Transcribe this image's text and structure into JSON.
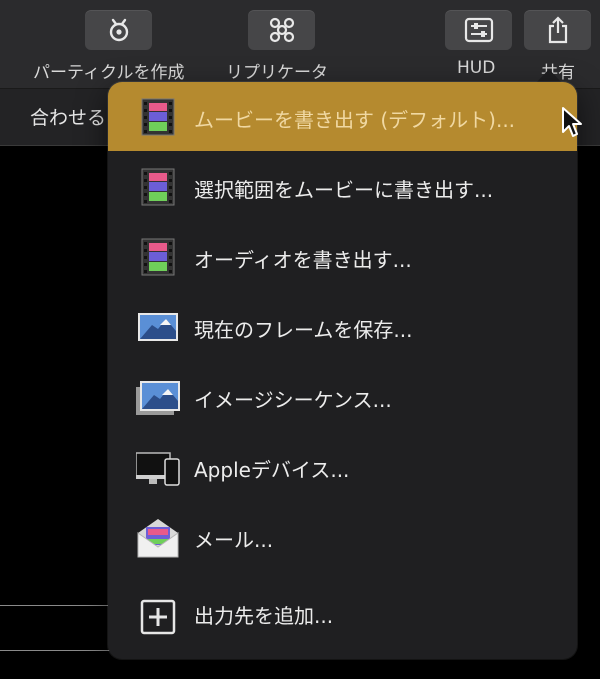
{
  "toolbar": {
    "particle_label": "パーティクルを作成",
    "replicator_label": "リプリケータ",
    "hud_label": "HUD",
    "share_label": "共有"
  },
  "subbar": {
    "label": "合わせる"
  },
  "menu": {
    "items": [
      {
        "label": "ムービーを書き出す (デフォルト)...",
        "icon": "film-icon",
        "highlighted": true
      },
      {
        "label": "選択範囲をムービーに書き出す...",
        "icon": "film-icon"
      },
      {
        "label": "オーディオを書き出す...",
        "icon": "film-icon"
      },
      {
        "label": "現在のフレームを保存...",
        "icon": "mountain-image-icon"
      },
      {
        "label": "イメージシーケンス...",
        "icon": "image-stack-icon"
      },
      {
        "label": "Appleデバイス...",
        "icon": "devices-icon"
      },
      {
        "label": "メール...",
        "icon": "mail-envelope-icon"
      },
      {
        "label": "出力先を追加...",
        "icon": "add-plus-icon"
      }
    ]
  },
  "colors": {
    "highlight": "#b58a2f",
    "menu_bg": "#1f1f21",
    "toolbar_bg": "#2b2b2d"
  }
}
